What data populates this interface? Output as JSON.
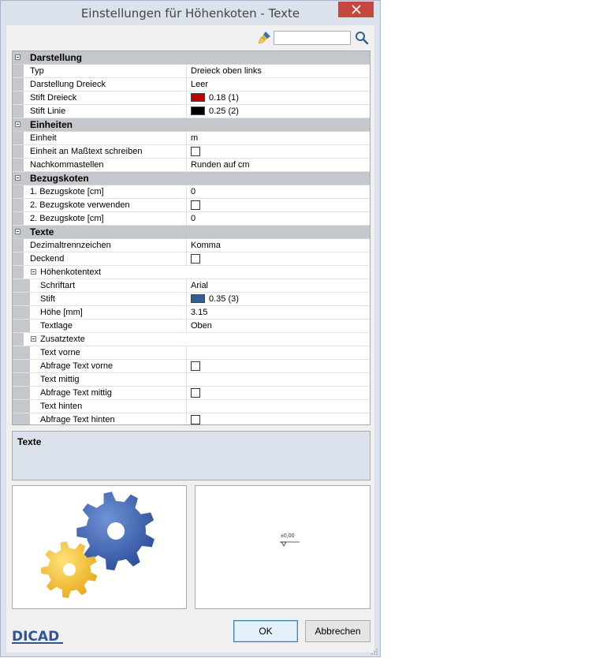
{
  "window": {
    "title": "Einstellungen für Höhenkoten - Texte"
  },
  "search": {
    "value": "",
    "placeholder": ""
  },
  "grid": {
    "rows": [
      {
        "kind": "cat",
        "label": "Darstellung"
      },
      {
        "kind": "prop",
        "name": "Typ",
        "type": "text",
        "value": "Dreieck oben links"
      },
      {
        "kind": "prop",
        "name": "Darstellung Dreieck",
        "type": "text",
        "value": "Leer"
      },
      {
        "kind": "prop",
        "name": "Stift Dreieck",
        "type": "swatch",
        "color": "#c00000",
        "value": "0.18 (1)"
      },
      {
        "kind": "prop",
        "name": "Stift Linie",
        "type": "swatch",
        "color": "#000000",
        "value": "0.25 (2)"
      },
      {
        "kind": "cat",
        "label": "Einheiten"
      },
      {
        "kind": "prop",
        "name": "Einheit",
        "type": "text",
        "value": "m"
      },
      {
        "kind": "prop",
        "name": "Einheit an Maßtext schreiben",
        "type": "check",
        "checked": false
      },
      {
        "kind": "prop",
        "name": "Nachkommastellen",
        "type": "text",
        "value": "Runden auf cm"
      },
      {
        "kind": "cat",
        "label": "Bezugskoten"
      },
      {
        "kind": "prop",
        "name": "1. Bezugskote [cm]",
        "type": "text",
        "value": "0"
      },
      {
        "kind": "prop",
        "name": "2. Bezugskote verwenden",
        "type": "check",
        "checked": false
      },
      {
        "kind": "prop",
        "name": "2. Bezugskote [cm]",
        "type": "text",
        "value": "0"
      },
      {
        "kind": "cat",
        "label": "Texte"
      },
      {
        "kind": "prop",
        "name": "Dezimaltrennzeichen",
        "type": "text",
        "value": "Komma"
      },
      {
        "kind": "prop",
        "name": "Deckend",
        "type": "check",
        "checked": false
      },
      {
        "kind": "sub",
        "label": "Höhenkotentext"
      },
      {
        "kind": "prop",
        "level": 2,
        "name": "Schriftart",
        "type": "text",
        "value": "Arial"
      },
      {
        "kind": "prop",
        "level": 2,
        "name": "Stift",
        "type": "swatch",
        "color": "#2f5f95",
        "value": "0.35 (3)"
      },
      {
        "kind": "prop",
        "level": 2,
        "name": "Höhe [mm]",
        "type": "text",
        "value": "3.15"
      },
      {
        "kind": "prop",
        "level": 2,
        "name": "Textlage",
        "type": "text",
        "value": "Oben"
      },
      {
        "kind": "sub",
        "label": "Zusatztexte"
      },
      {
        "kind": "prop",
        "level": 2,
        "name": "Text vorne",
        "type": "text",
        "value": ""
      },
      {
        "kind": "prop",
        "level": 2,
        "name": "Abfrage Text vorne",
        "type": "check",
        "checked": false
      },
      {
        "kind": "prop",
        "level": 2,
        "name": "Text mittig",
        "type": "text",
        "value": ""
      },
      {
        "kind": "prop",
        "level": 2,
        "name": "Abfrage Text mittig",
        "type": "check",
        "checked": false
      },
      {
        "kind": "prop",
        "level": 2,
        "name": "Text hinten",
        "type": "text",
        "value": ""
      },
      {
        "kind": "prop",
        "level": 2,
        "name": "Abfrage Text hinten",
        "type": "check",
        "checked": false
      }
    ]
  },
  "description": {
    "title": "Texte"
  },
  "preview": {
    "level_text": "±0,00"
  },
  "brand": {
    "logo_text": "DICAD"
  },
  "buttons": {
    "ok_label": "OK",
    "cancel_label": "Abbrechen"
  }
}
